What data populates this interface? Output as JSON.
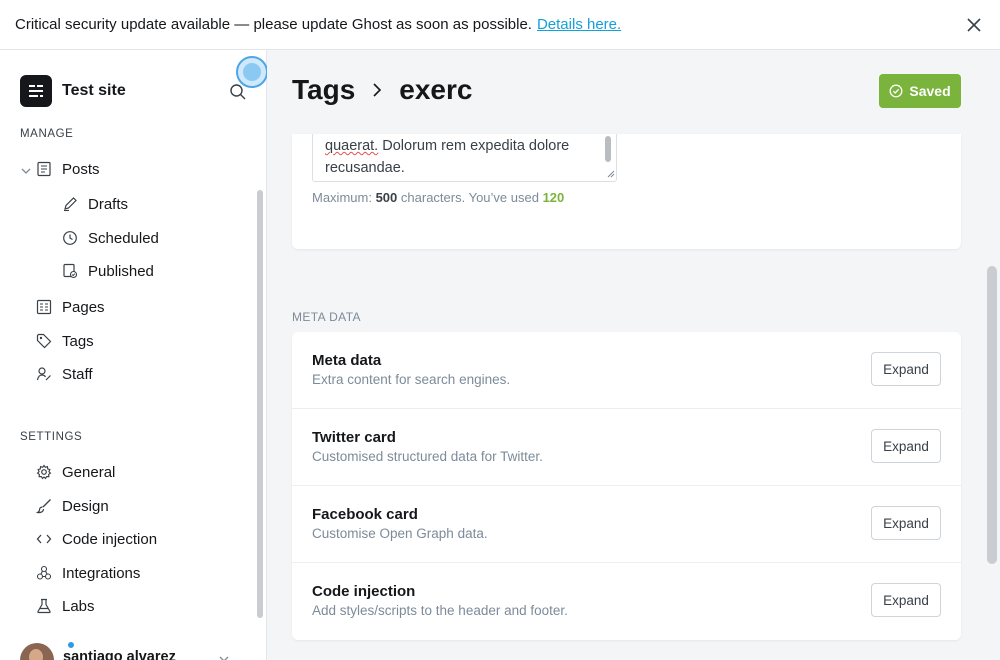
{
  "banner": {
    "message": "Critical security update available — please update Ghost as soon as possible.",
    "link_text": "Details here."
  },
  "sidebar": {
    "site_title": "Test site",
    "manage_label": "MANAGE",
    "manage_items": [
      {
        "label": "Posts",
        "icon": "posts-icon"
      },
      {
        "label": "Drafts",
        "icon": "pencil-icon"
      },
      {
        "label": "Scheduled",
        "icon": "clock-icon"
      },
      {
        "label": "Published",
        "icon": "published-icon"
      },
      {
        "label": "Pages",
        "icon": "pages-icon"
      },
      {
        "label": "Tags",
        "icon": "tag-icon"
      },
      {
        "label": "Staff",
        "icon": "staff-icon"
      }
    ],
    "settings_label": "SETTINGS",
    "settings_items": [
      {
        "label": "General",
        "icon": "gear-icon"
      },
      {
        "label": "Design",
        "icon": "brush-icon"
      },
      {
        "label": "Code injection",
        "icon": "code-icon"
      },
      {
        "label": "Integrations",
        "icon": "integrations-icon"
      },
      {
        "label": "Labs",
        "icon": "flask-icon"
      }
    ],
    "user": {
      "name": "santiago alvarez"
    }
  },
  "header": {
    "breadcrumb_parent": "Tags",
    "breadcrumb_current": "exerc",
    "saved_label": "Saved"
  },
  "description": {
    "text_line1": "quaerat.",
    "text_line1_rest": "Dolorum rem expedita dolore",
    "text_line2": "recusandae.",
    "hint_prefix": "Maximum:",
    "hint_max": "500",
    "hint_middle": "characters. You’ve used",
    "hint_used": "120"
  },
  "meta": {
    "section_label": "META DATA",
    "rows": [
      {
        "title": "Meta data",
        "description": "Extra content for search engines.",
        "button": "Expand"
      },
      {
        "title": "Twitter card",
        "description": "Customised structured data for Twitter.",
        "button": "Expand"
      },
      {
        "title": "Facebook card",
        "description": "Customise Open Graph data.",
        "button": "Expand"
      },
      {
        "title": "Code injection",
        "description": "Add styles/scripts to the header and footer.",
        "button": "Expand"
      }
    ]
  },
  "colors": {
    "accent_green": "#7ab43c",
    "link_blue": "#14a1d9"
  }
}
